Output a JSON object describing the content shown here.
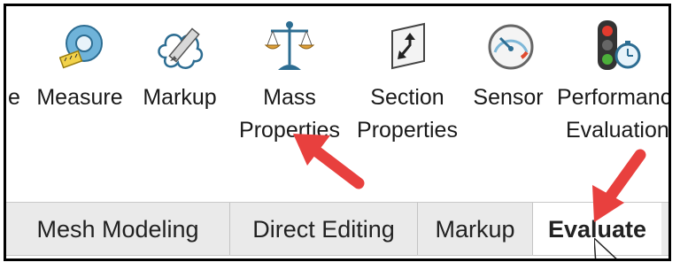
{
  "ribbon": {
    "tools": [
      {
        "label_line1": "e",
        "label_line2": "",
        "icon": "partial-tool-icon"
      },
      {
        "label_line1": "Measure",
        "label_line2": "",
        "icon": "tape-measure-icon"
      },
      {
        "label_line1": "Markup",
        "label_line2": "",
        "icon": "cloud-pencil-icon"
      },
      {
        "label_line1": "Mass",
        "label_line2": "Properties",
        "icon": "balance-scale-icon"
      },
      {
        "label_line1": "Section",
        "label_line2": "Properties",
        "icon": "section-plane-icon"
      },
      {
        "label_line1": "Sensor",
        "label_line2": "",
        "icon": "gauge-icon"
      },
      {
        "label_line1": "Performanc",
        "label_line2": "Evaluation",
        "icon": "traffic-light-stopwatch-icon"
      }
    ]
  },
  "tabs": [
    {
      "label": "Mesh Modeling",
      "active": false
    },
    {
      "label": "Direct Editing",
      "active": false
    },
    {
      "label": "Markup",
      "active": false
    },
    {
      "label": "Evaluate",
      "active": true
    }
  ],
  "annotations": {
    "arrow_color": "#e8403e",
    "arrows": [
      "arrow-to-mass-properties",
      "arrow-to-evaluate-tab"
    ]
  }
}
